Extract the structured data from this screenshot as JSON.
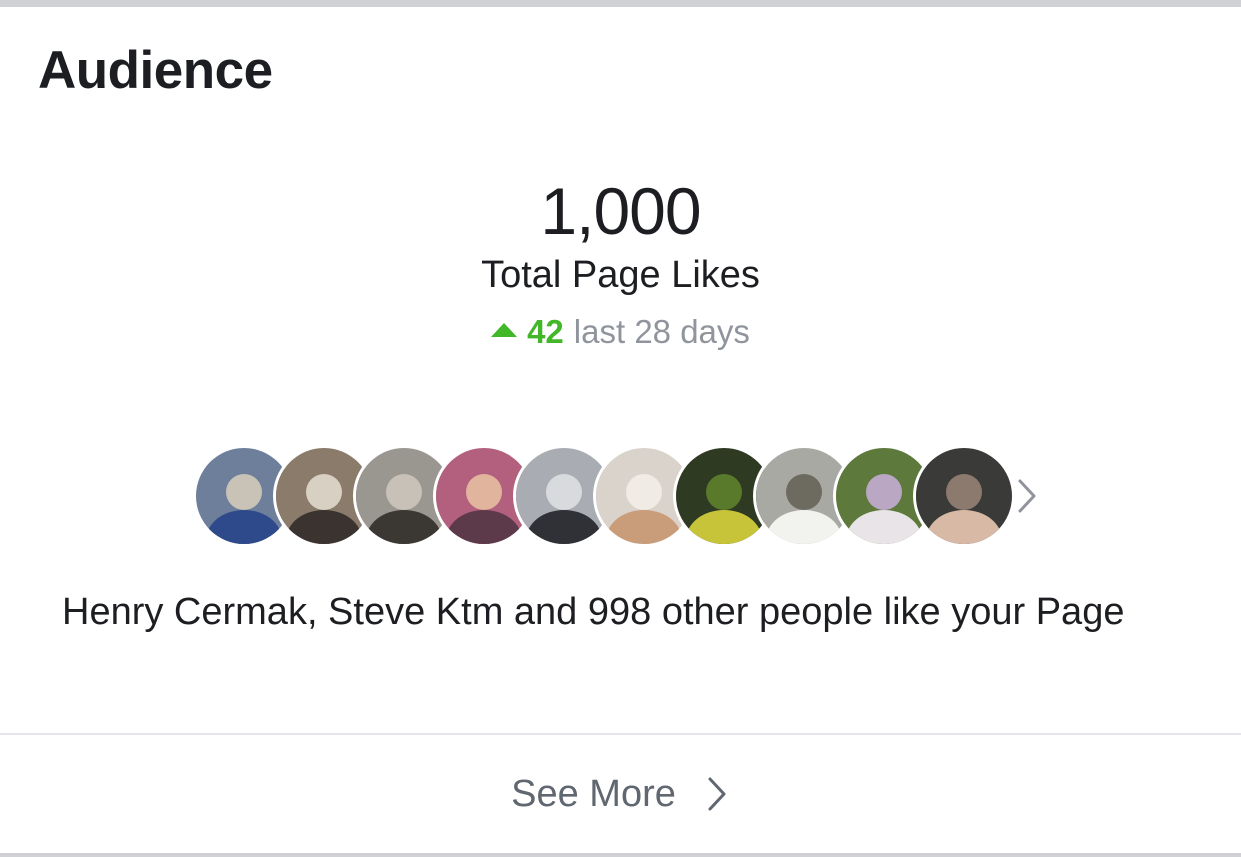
{
  "card": {
    "title": "Audience",
    "total_likes": "1,000",
    "total_likes_label": "Total Page Likes",
    "change_value": "42",
    "change_period": "last 28 days",
    "change_direction": "up",
    "change_color": "#42b72a"
  },
  "avatars": [
    {
      "name": "avatar-1",
      "colors": [
        "#6d7f9a",
        "#2f4a8a",
        "#c9c2b6"
      ]
    },
    {
      "name": "avatar-2",
      "colors": [
        "#8a7b6a",
        "#3a3330",
        "#d9d0c4"
      ]
    },
    {
      "name": "avatar-3",
      "colors": [
        "#9a9690",
        "#3b3733",
        "#c7c1b8"
      ]
    },
    {
      "name": "avatar-4",
      "colors": [
        "#b3607e",
        "#5c3a4a",
        "#e1b49e"
      ]
    },
    {
      "name": "avatar-5",
      "colors": [
        "#a9adb3",
        "#2f3136",
        "#d8dadd"
      ]
    },
    {
      "name": "avatar-6",
      "colors": [
        "#d9d3cb",
        "#c99c7a",
        "#f0ebe4"
      ]
    },
    {
      "name": "avatar-7",
      "colors": [
        "#2f3a23",
        "#c8c43a",
        "#5a7a2b"
      ]
    },
    {
      "name": "avatar-8",
      "colors": [
        "#a7a9a2",
        "#f2f2ef",
        "#6d6a60"
      ]
    },
    {
      "name": "avatar-9",
      "colors": [
        "#5d7a3c",
        "#e9e4e7",
        "#b9a7c4"
      ]
    },
    {
      "name": "avatar-10",
      "colors": [
        "#3a3a38",
        "#d8b9a6",
        "#8c7a6e"
      ]
    }
  ],
  "likers_text": "Henry Cermak, Steve Ktm and 998 other people like your Page",
  "footer": {
    "see_more_label": "See More"
  },
  "icons": {
    "change_indicator": "triangle-up-icon",
    "avatars_more": "chevron-right-icon",
    "see_more": "chevron-right-icon"
  }
}
